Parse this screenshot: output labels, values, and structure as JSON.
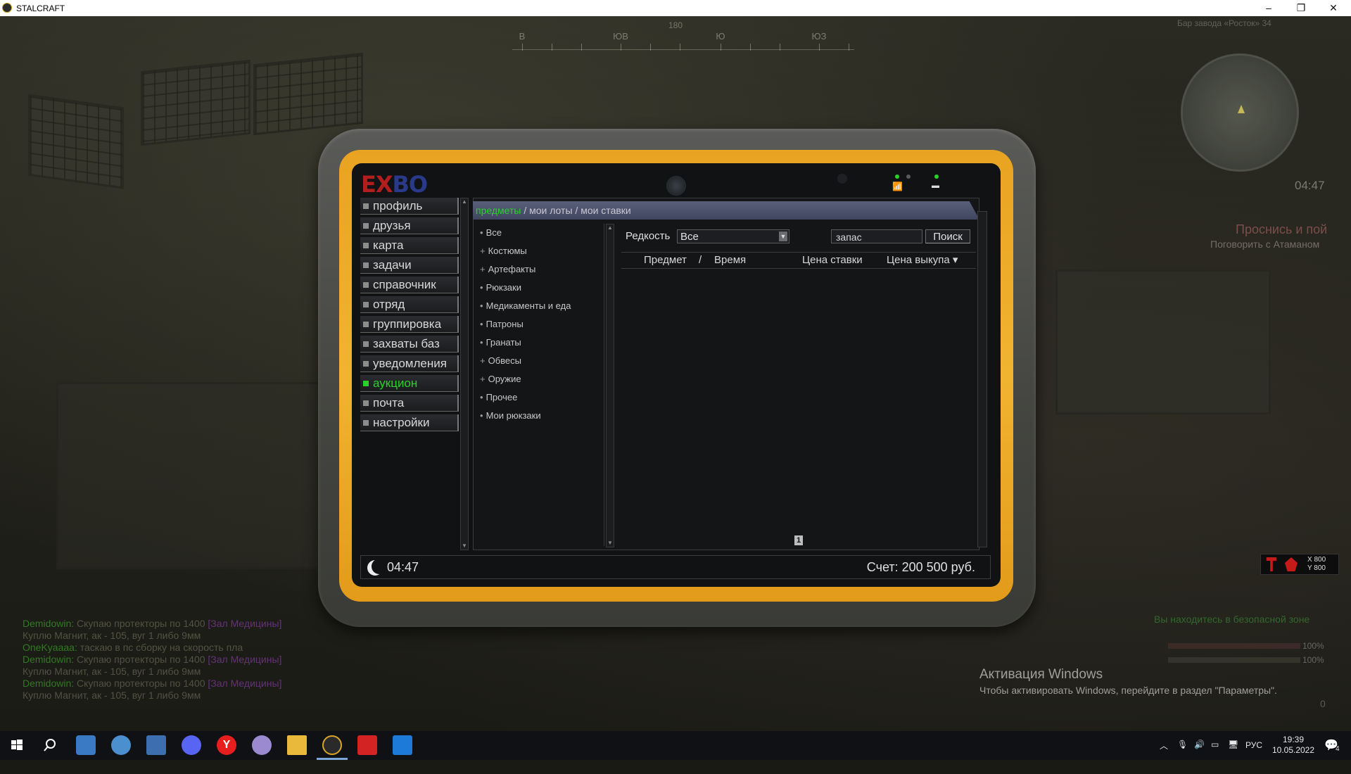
{
  "window": {
    "title": "STALCRAFT",
    "buttons": {
      "minimize": "–",
      "restore": "❐",
      "close": "✕"
    }
  },
  "hud": {
    "compass": {
      "labels": [
        "В",
        "ЮВ",
        "Ю",
        "ЮЗ"
      ],
      "degree": "180"
    },
    "location": "Бар завода «Росток» 34",
    "time": "04:47",
    "quest": {
      "title": "Проснись и пой",
      "subtitle": "Поговорить с Атаманом"
    },
    "chat": [
      {
        "nick": "Demidowin:",
        "msg": " Скупаю протекторы по 1400 ",
        "tag": "[Зал Медицины]"
      },
      {
        "nick": "",
        "msg": "Куплю Магнит, ак - 105, вуг 1 либо 9мм",
        "tag": ""
      },
      {
        "nick": "OneKyaaaa:",
        "msg": " таскаю в пс сборку на скорость пла",
        "tag": ""
      },
      {
        "nick": "Demidowin:",
        "msg": " Скупаю протекторы по 1400 ",
        "tag": "[Зал Медицины]"
      },
      {
        "nick": "",
        "msg": "Куплю Магнит, ак - 105, вуг 1 либо 9мм",
        "tag": ""
      },
      {
        "nick": "Demidowin:",
        "msg": " Скупаю протекторы по 1400 ",
        "tag": "[Зал Медицины]"
      },
      {
        "nick": "",
        "msg": "Куплю Магнит, ак - 105, вуг 1 либо 9мм",
        "tag": ""
      }
    ],
    "safe_zone": "Вы находитесь в безопасной зоне",
    "health_pct": "100%",
    "stamina_pct": "100%",
    "coords": {
      "x": "X 800",
      "y": "Y 800"
    },
    "ammo": "0"
  },
  "activation": {
    "title": "Активация Windows",
    "text": "Чтобы активировать Windows, перейдите в раздел \"Параметры\"."
  },
  "tablet": {
    "logo_a": "EX",
    "logo_b": "BO",
    "menu": [
      {
        "label": "профиль",
        "active": false
      },
      {
        "label": "друзья",
        "active": false
      },
      {
        "label": "карта",
        "active": false
      },
      {
        "label": "задачи",
        "active": false
      },
      {
        "label": "справочник",
        "active": false
      },
      {
        "label": "отряд",
        "active": false
      },
      {
        "label": "группировка",
        "active": false
      },
      {
        "label": "захваты баз",
        "active": false
      },
      {
        "label": "уведомления",
        "active": false
      },
      {
        "label": "аукцион",
        "active": true
      },
      {
        "label": "почта",
        "active": false
      },
      {
        "label": "настройки",
        "active": false
      }
    ],
    "tabs": {
      "items": "предметы",
      "sep": " / ",
      "my_lots": "мои лоты",
      "my_bids": "мои ставки"
    },
    "categories": [
      {
        "bullet": "•",
        "label": "Все"
      },
      {
        "bullet": "+",
        "label": "Костюмы"
      },
      {
        "bullet": "+",
        "label": "Артефакты"
      },
      {
        "bullet": "•",
        "label": "Рюкзаки"
      },
      {
        "bullet": "•",
        "label": "Медикаменты и еда"
      },
      {
        "bullet": "•",
        "label": "Патроны"
      },
      {
        "bullet": "•",
        "label": "Гранаты"
      },
      {
        "bullet": "+",
        "label": "Обвесы"
      },
      {
        "bullet": "+",
        "label": "Оружие"
      },
      {
        "bullet": "•",
        "label": "Прочее"
      },
      {
        "bullet": "•",
        "label": "Мои рюкзаки"
      }
    ],
    "rarity_label": "Редкость",
    "rarity_value": "Все",
    "search_value": "запас",
    "search_button": "Поиск",
    "columns": {
      "item": "Предмет",
      "slash": "/",
      "time": "Время",
      "bid_price": "Цена ставки",
      "buyout_price": "Цена выкупа ▾"
    },
    "page": "1",
    "footer_time": "04:47",
    "balance": "Счет: 200 500 руб."
  },
  "taskbar": {
    "lang": "РУС",
    "time": "19:39",
    "date": "10.05.2022",
    "notifications": "4"
  }
}
